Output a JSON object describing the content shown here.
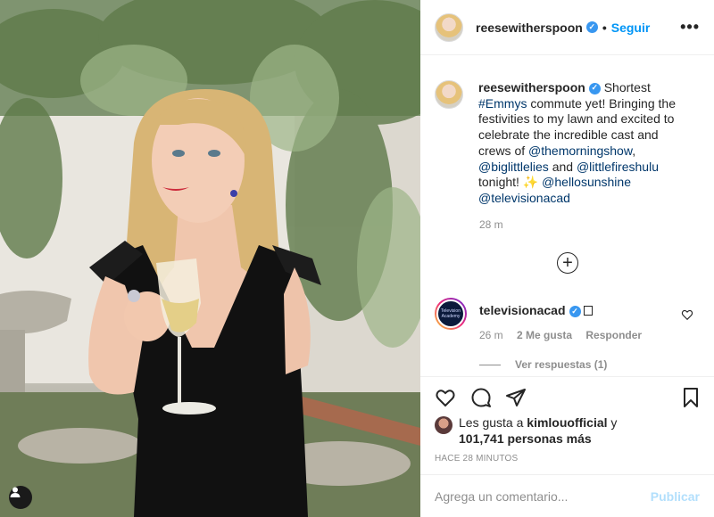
{
  "post": {
    "author": "reesewitherspoon",
    "follow_label": "Seguir",
    "separator": "•",
    "more_label": "•••"
  },
  "caption": {
    "author": "reesewitherspoon",
    "t1": " Shortest ",
    "emmys": "#Emmys",
    "t2": " commute yet! Bringing the festivities to my lawn and excited to celebrate the incredible cast and crews of ",
    "m1": "@themorningshow",
    "t3": ", ",
    "m2": "@biglittlelies",
    "t4": " and ",
    "m3": "@littlefireshulu",
    "t5": " tonight! ",
    "sparkle": "✨",
    "t6": " ",
    "m4": "@hellosunshine",
    "t7": " ",
    "m5": "@televisionacad",
    "time": "28 m"
  },
  "load_more_label": "+",
  "comment": {
    "author": "televisionacad",
    "avatar_text": "Television Academy",
    "time": "26 m",
    "likes": "2 Me gusta",
    "reply_label": "Responder",
    "view_replies": "Ver respuestas (1)"
  },
  "likes": {
    "prefix": "Les gusta a ",
    "user": "kimlouofficial",
    "suffix": " y",
    "count_text": "101,741 personas más"
  },
  "posted_ago": "HACE 28 MINUTOS",
  "add_comment": {
    "placeholder": "Agrega un comentario...",
    "post_label": "Publicar"
  },
  "colors": {
    "accent": "#0095f6",
    "link": "#00376b",
    "muted": "#8e8e8e",
    "post_disabled": "#b2dffc"
  }
}
